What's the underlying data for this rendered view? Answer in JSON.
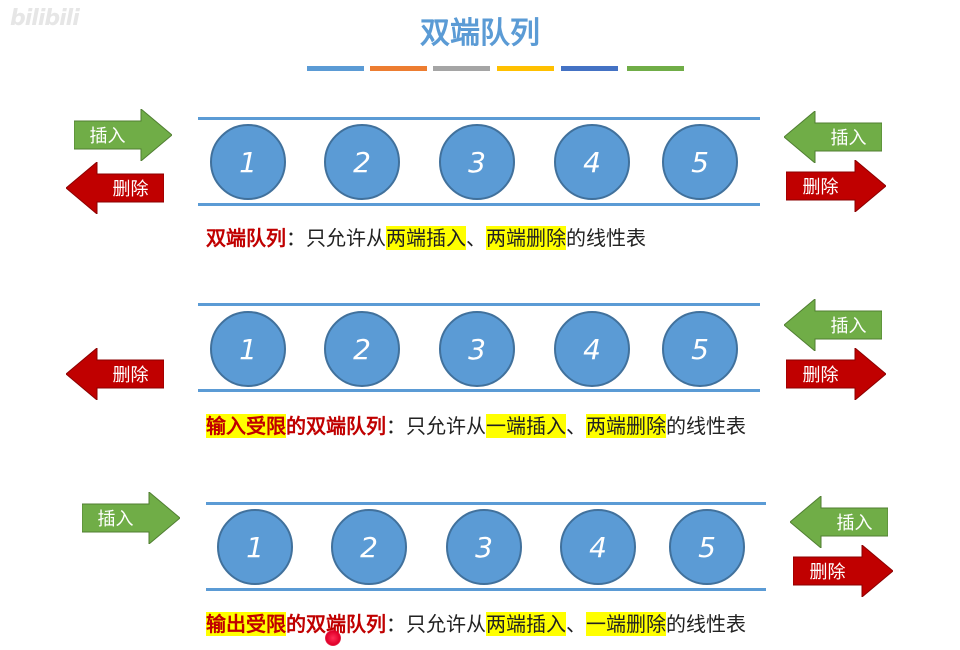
{
  "watermark": "bilibili",
  "title": "双端队列",
  "accent_colors": [
    "#5b9bd5",
    "#ed7d31",
    "#a5a5a5",
    "#ffc000",
    "#4472c4",
    "#70ad47"
  ],
  "labels": {
    "insert": "插入",
    "delete": "删除"
  },
  "rows": [
    {
      "circles": [
        "1",
        "2",
        "3",
        "4",
        "5"
      ],
      "desc": {
        "term": "双端队列",
        "colon": "：",
        "t1": "只允许从",
        "h1": "两端插入",
        "sep": "、",
        "h2": "两端删除",
        "t2": "的线性表"
      }
    },
    {
      "circles": [
        "1",
        "2",
        "3",
        "4",
        "5"
      ],
      "desc": {
        "term_hl": "输入受限",
        "term_rest": "的双端队列",
        "colon": "：",
        "t1": "只允许从",
        "h1": "一端插入",
        "sep": "、",
        "h2": "两端删除",
        "t2": "的线性表"
      }
    },
    {
      "circles": [
        "1",
        "2",
        "3",
        "4",
        "5"
      ],
      "desc": {
        "term_hl": "输出受限",
        "term_rest": "的双端队列",
        "colon": "：",
        "t1": "只允许从",
        "h1": "两端插入",
        "sep": "、",
        "h2": "一端删除",
        "t2": "的线性表"
      }
    }
  ]
}
